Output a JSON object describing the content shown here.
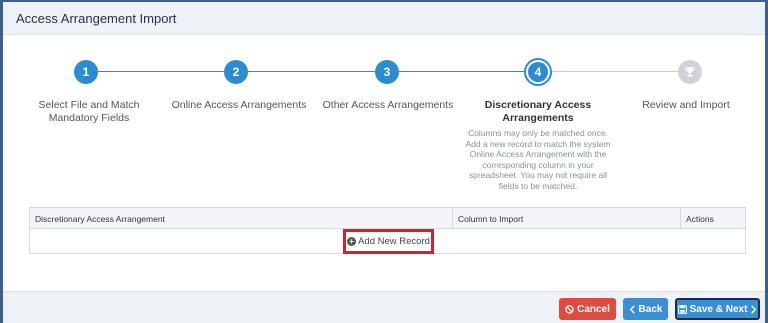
{
  "modal": {
    "title": "Access Arrangement Import"
  },
  "steps": [
    {
      "number": "1",
      "label": "Select File and Match Mandatory Fields"
    },
    {
      "number": "2",
      "label": "Online Access Arrangements"
    },
    {
      "number": "3",
      "label": "Other Access Arrangements"
    },
    {
      "number": "4",
      "label": "Discretionary Access Arrangements"
    },
    {
      "number": "",
      "label": "Review and Import"
    }
  ],
  "step_help": "Columns may only be matched once. Add a new record to match the system Online Access Arrangement with the corresponding column in your spreadsheet. You may not require all fields to be matched.",
  "table": {
    "headers": [
      "Discretionary Access Arrangement",
      "Column to Import",
      "Actions"
    ],
    "add_record_label": "Add New Record"
  },
  "footer": {
    "cancel_label": "Cancel",
    "back_label": "Back",
    "next_label": "Save & Next"
  },
  "colors": {
    "primary": "#2b8ccf",
    "danger": "#e04b3f",
    "highlight": "#d3222a"
  }
}
